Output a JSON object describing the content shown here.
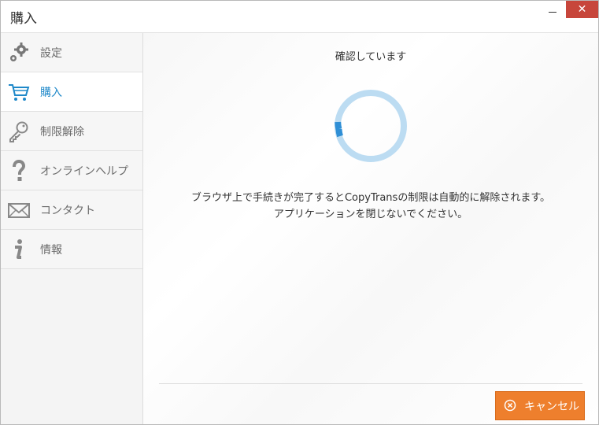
{
  "window": {
    "title": "購入",
    "close_glyph": "✕"
  },
  "sidebar": {
    "items": [
      {
        "label": "設定",
        "icon": "gear-icon",
        "active": false
      },
      {
        "label": "購入",
        "icon": "cart-icon",
        "active": true
      },
      {
        "label": "制限解除",
        "icon": "key-icon",
        "active": false
      },
      {
        "label": "オンラインヘルプ",
        "icon": "question-icon",
        "active": false
      },
      {
        "label": "コンタクト",
        "icon": "envelope-icon",
        "active": false
      },
      {
        "label": "情報",
        "icon": "info-icon",
        "active": false
      }
    ]
  },
  "main": {
    "status_title": "確認しています",
    "message_line1": "ブラウザ上で手続きが完了するとCopyTransの制限は自動的に解除されます。",
    "message_line2": "アプリケーションを閉じないでください。",
    "cancel_label": "キャンセル"
  },
  "colors": {
    "accent": "#1e88c9",
    "cancel": "#ee7f2d",
    "close": "#c7463b",
    "spinner_track": "#bcdcf2",
    "spinner_arc": "#2f8fd6"
  }
}
